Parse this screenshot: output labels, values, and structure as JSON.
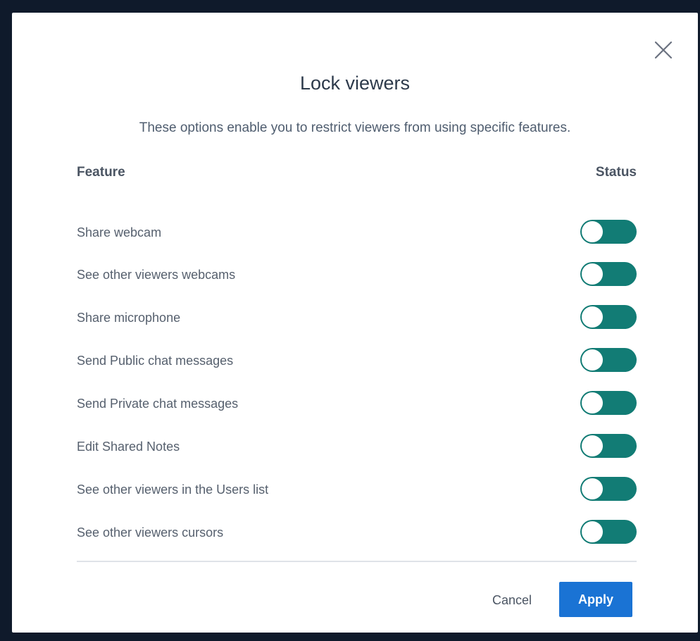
{
  "dialog": {
    "title": "Lock viewers",
    "description": "These options enable you to restrict viewers from using specific features.",
    "close_icon": "close-icon"
  },
  "table": {
    "header_feature": "Feature",
    "header_status": "Status",
    "rows": [
      {
        "label": "Share webcam",
        "toggle_on": true
      },
      {
        "label": "See other viewers webcams",
        "toggle_on": true
      },
      {
        "label": "Share microphone",
        "toggle_on": true
      },
      {
        "label": "Send Public chat messages",
        "toggle_on": true
      },
      {
        "label": "Send Private chat messages",
        "toggle_on": true
      },
      {
        "label": "Edit Shared Notes",
        "toggle_on": true
      },
      {
        "label": "See other viewers in the Users list",
        "toggle_on": true
      },
      {
        "label": "See other viewers cursors",
        "toggle_on": true
      }
    ]
  },
  "footer": {
    "cancel_label": "Cancel",
    "apply_label": "Apply"
  },
  "colors": {
    "toggle_track": "#127c75",
    "apply_button": "#1a73d4",
    "backdrop": "#0f1a2b"
  }
}
